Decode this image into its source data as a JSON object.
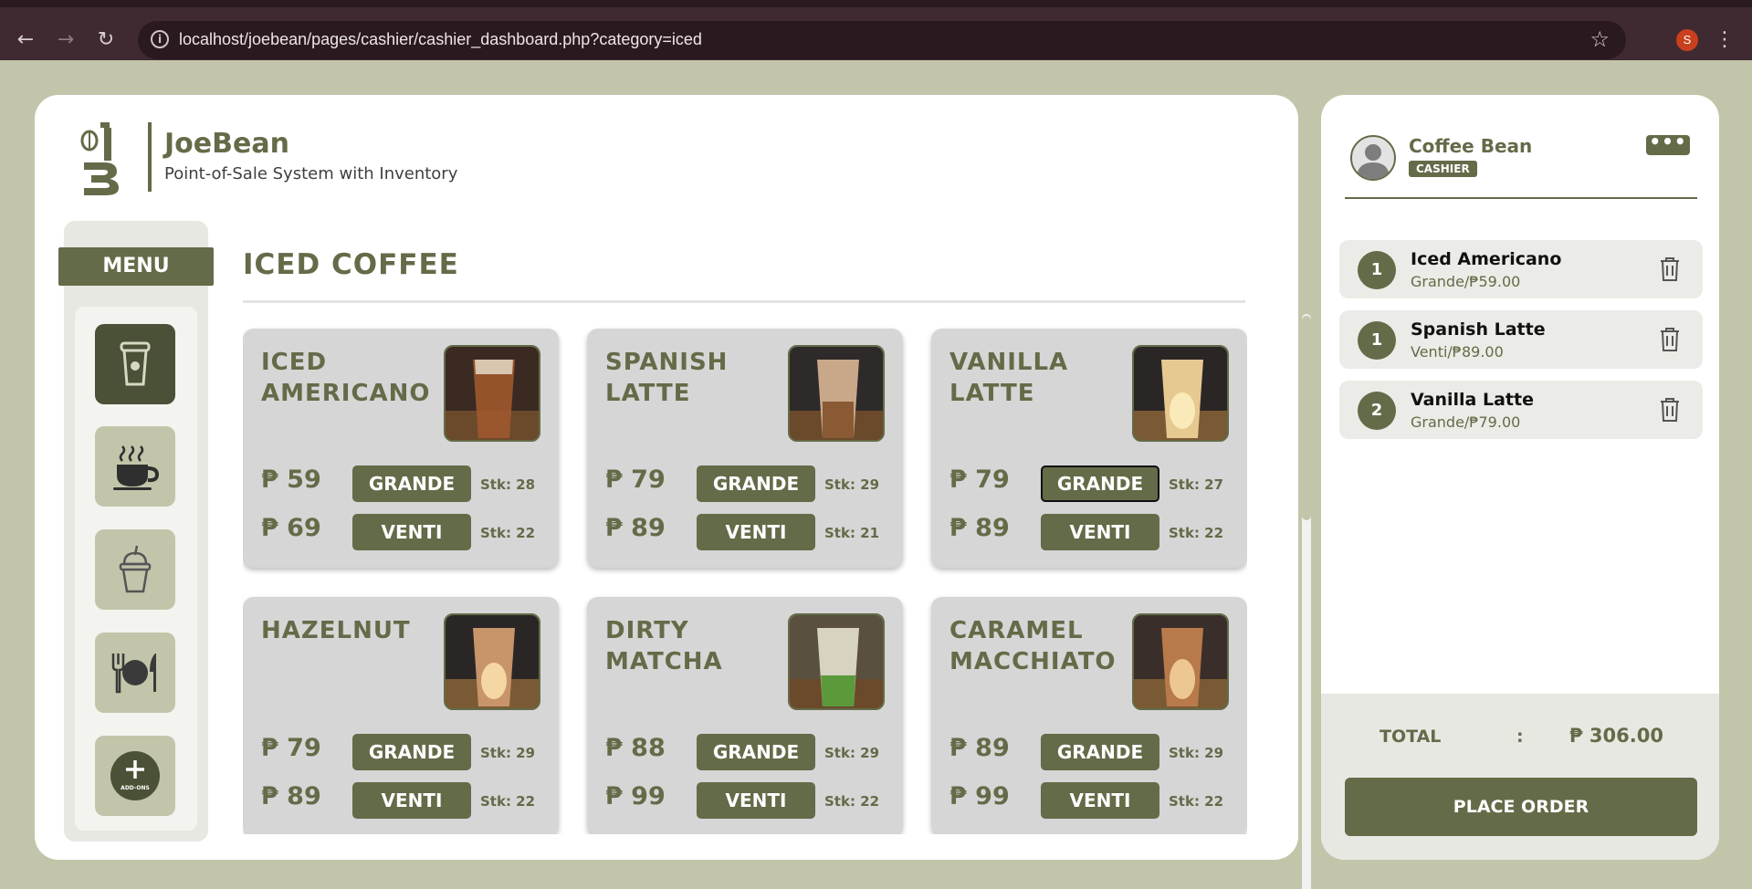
{
  "browser": {
    "url": "localhost/joebean/pages/cashier/cashier_dashboard.php?category=iced",
    "profile_initial": "S"
  },
  "brand": {
    "name": "JoeBean",
    "subtitle": "Point-of-Sale System with Inventory"
  },
  "sidebar": {
    "menu_label": "MENU",
    "categories": [
      {
        "icon": "iced-cup-icon",
        "active": true
      },
      {
        "icon": "hot-coffee-icon",
        "active": false
      },
      {
        "icon": "frappe-cup-icon",
        "active": false
      },
      {
        "icon": "meal-icon",
        "active": false
      },
      {
        "icon": "add-ons-icon",
        "active": false,
        "label": "ADD-ONS"
      }
    ]
  },
  "section": {
    "title": "ICED COFFEE"
  },
  "products": [
    {
      "name": "ICED AMERICANO",
      "grande": {
        "price": "₱ 59",
        "size": "GRANDE",
        "stock": "Stk: 28"
      },
      "venti": {
        "price": "₱ 69",
        "size": "VENTI",
        "stock": "Stk: 22"
      }
    },
    {
      "name": "SPANISH LATTE",
      "grande": {
        "price": "₱ 79",
        "size": "GRANDE",
        "stock": "Stk: 29"
      },
      "venti": {
        "price": "₱ 89",
        "size": "VENTI",
        "stock": "Stk: 21"
      }
    },
    {
      "name": "VANILLA LATTE",
      "grande": {
        "price": "₱ 79",
        "size": "GRANDE",
        "stock": "Stk: 27"
      },
      "venti": {
        "price": "₱ 89",
        "size": "VENTI",
        "stock": "Stk: 22"
      }
    },
    {
      "name": "HAZELNUT",
      "grande": {
        "price": "₱ 79",
        "size": "GRANDE",
        "stock": "Stk: 29"
      },
      "venti": {
        "price": "₱ 89",
        "size": "VENTI",
        "stock": "Stk: 22"
      }
    },
    {
      "name": "DIRTY MATCHA",
      "grande": {
        "price": "₱ 88",
        "size": "GRANDE",
        "stock": "Stk: 29"
      },
      "venti": {
        "price": "₱ 99",
        "size": "VENTI",
        "stock": "Stk: 22"
      }
    },
    {
      "name": "CARAMEL MACCHIATO",
      "grande": {
        "price": "₱ 89",
        "size": "GRANDE",
        "stock": "Stk: 29"
      },
      "venti": {
        "price": "₱ 99",
        "size": "VENTI",
        "stock": "Stk: 22"
      }
    }
  ],
  "user": {
    "name": "Coffee Bean",
    "role": "CASHIER",
    "more_label": "•••"
  },
  "order": {
    "items": [
      {
        "qty": "1",
        "name": "Iced Americano",
        "detail": "Grande/₱59.00"
      },
      {
        "qty": "1",
        "name": "Spanish Latte",
        "detail": "Venti/₱89.00"
      },
      {
        "qty": "2",
        "name": "Vanilla Latte",
        "detail": "Grande/₱79.00"
      }
    ],
    "total_label": "TOTAL",
    "total_colon": ":",
    "total_value": "₱ 306.00",
    "place_order_label": "PLACE ORDER"
  },
  "colors": {
    "primary": "#646b48",
    "background": "#c3c5aa",
    "card": "#d6d6d6"
  }
}
